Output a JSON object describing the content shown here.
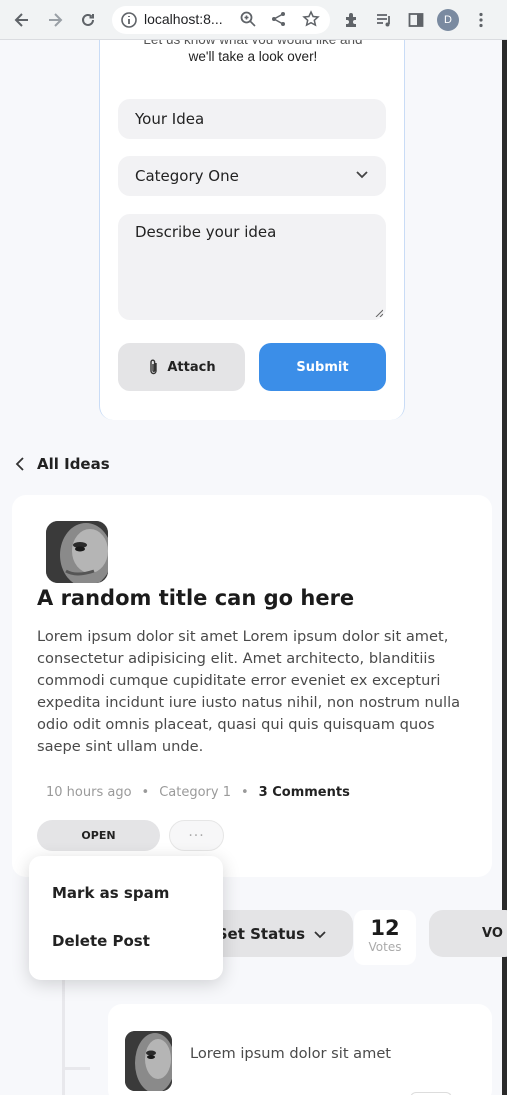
{
  "browser": {
    "url": "localhost:8...",
    "profile_initial": "D"
  },
  "form": {
    "intro_line1": "Let us know what you would like and",
    "intro_line2": "we'll take a look over!",
    "title_placeholder": "Your Idea",
    "category_selected": "Category One",
    "description_placeholder": "Describe your idea",
    "attach_label": "Attach",
    "submit_label": "Submit"
  },
  "nav": {
    "back_label": "All Ideas"
  },
  "idea": {
    "title": "A random title can go here",
    "body": "Lorem ipsum dolor sit amet Lorem ipsum dolor sit amet, consectetur adipisicing elit. Amet architecto, blanditiis commodi cumque cupiditate error eveniet ex excepturi expedita incidunt iure iusto natus nihil, non nostrum nulla odio odit omnis placeat, quasi qui quis quisquam quos saepe sint ullam unde.",
    "time": "10 hours ago",
    "separator": "•",
    "category": "Category 1",
    "comments": "3 Comments",
    "status": "OPEN",
    "more_label": "···"
  },
  "menu": {
    "items": [
      {
        "label": "Mark as spam"
      },
      {
        "label": "Delete Post"
      }
    ]
  },
  "actions": {
    "set_status_label": "Set Status",
    "votes_count": "12",
    "votes_label": "Votes",
    "vote_button_label": "VO"
  },
  "comment": {
    "text": "Lorem ipsum dolor sit amet"
  },
  "colors": {
    "accent": "#3b8ee8",
    "background": "#f7f8fb"
  }
}
